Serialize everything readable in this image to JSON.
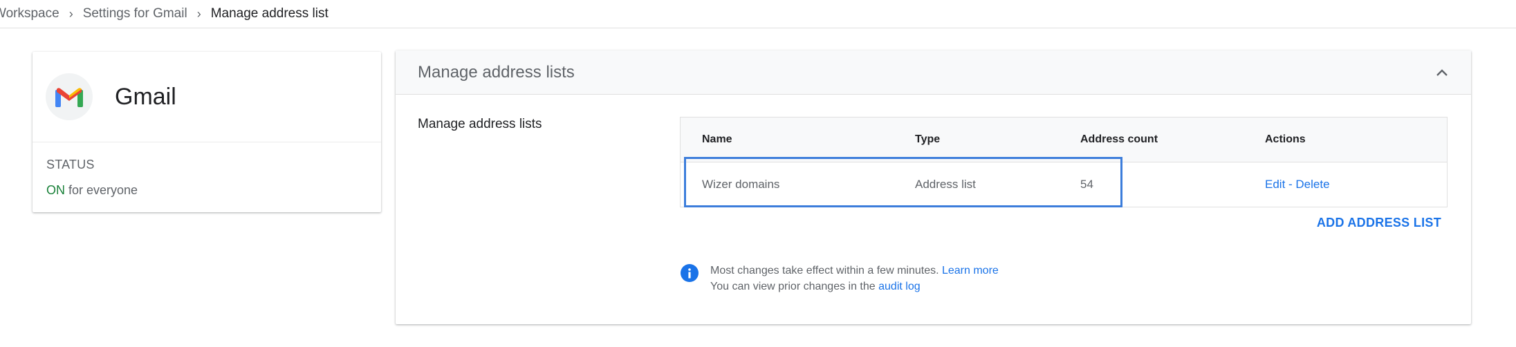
{
  "breadcrumb": {
    "items": [
      "Workspace",
      "Settings for Gmail",
      "Manage address list"
    ]
  },
  "app_card": {
    "name": "Gmail",
    "logo_icon": "gmail-logo-icon",
    "status_label": "STATUS",
    "status_on": "ON",
    "status_rest": " for everyone"
  },
  "panel": {
    "title": "Manage address lists",
    "section_label": "Manage address lists",
    "columns": [
      "Name",
      "Type",
      "Address count",
      "Actions"
    ],
    "rows": [
      {
        "name": "Wizer domains",
        "type": "Address list",
        "count": "54",
        "edit": "Edit",
        "sep": " - ",
        "delete": "Delete"
      }
    ],
    "add_button": "ADD ADDRESS LIST",
    "info_line1": "Most changes take effect within a few minutes. ",
    "learn_more": "Learn more",
    "info_line2": "You can view prior changes in the ",
    "audit_log": "audit log"
  },
  "colors": {
    "accent": "#1a73e8",
    "status_on": "#188038",
    "highlight": "#3c7ddb"
  }
}
